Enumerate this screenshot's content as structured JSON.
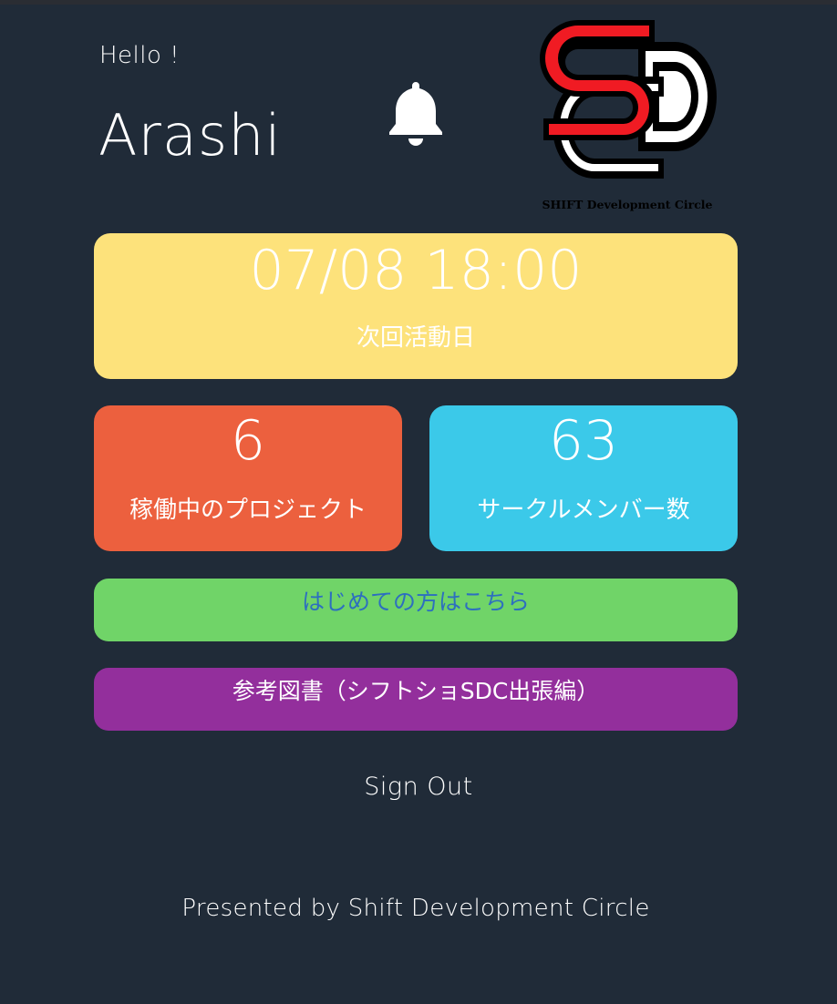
{
  "header": {
    "greeting": "Hello !",
    "username": "Arashi",
    "bell_icon": "bell-icon",
    "logo_caption": "SHIFT Development Circle"
  },
  "next_activity": {
    "datetime": "07/08 18:00",
    "label": "次回活動日"
  },
  "stats": {
    "projects": {
      "value": "6",
      "label": "稼働中のプロジェクト"
    },
    "members": {
      "value": "63",
      "label": "サークルメンバー数"
    }
  },
  "buttons": {
    "first_time": "はじめての方はこちら",
    "reference_books": "参考図書（シフトショSDC出張編）"
  },
  "sign_out": "Sign Out",
  "footer": "Presented by Shift Development Circle",
  "colors": {
    "background": "#202b38",
    "next_card": "#fde27b",
    "projects_card": "#ec603e",
    "members_card": "#3bc9e9",
    "first_time_button": "#70d468",
    "books_button": "#932f9c",
    "logo_red": "#f01b23"
  }
}
